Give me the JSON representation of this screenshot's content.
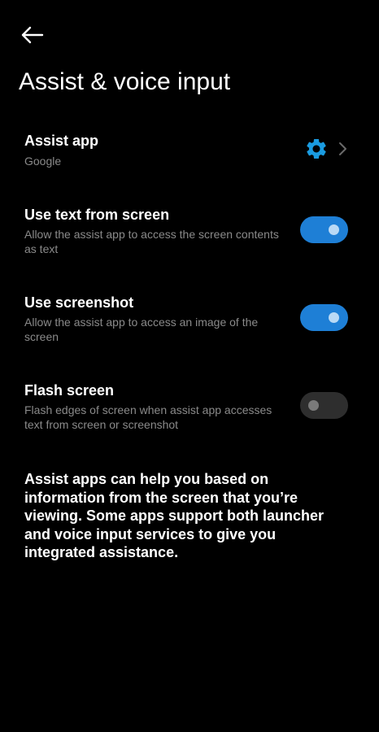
{
  "header": {
    "back_icon": "arrow-left-icon",
    "title": "Assist & voice input"
  },
  "settings": {
    "assist_app": {
      "title": "Assist app",
      "value": "Google",
      "gear_icon": "gear-icon",
      "chevron_icon": "chevron-right-icon"
    },
    "use_text": {
      "title": "Use text from screen",
      "description": "Allow the assist app to access the screen contents as text",
      "enabled": true
    },
    "use_screenshot": {
      "title": "Use screenshot",
      "description": "Allow the assist app to access an image of the screen",
      "enabled": true
    },
    "flash_screen": {
      "title": "Flash screen",
      "description": "Flash edges of screen when assist app accesses text from screen or screenshot",
      "enabled": false
    }
  },
  "footer": {
    "info": "Assist apps can help you based on information from the screen that you’re viewing. Some apps support both launcher and voice input services to give you integrated assistance."
  },
  "colors": {
    "background": "#000000",
    "accent": "#1e7fd6",
    "gear": "#1a9be0",
    "secondary_text": "#8a8a8a",
    "switch_off": "#2e2e2e"
  }
}
